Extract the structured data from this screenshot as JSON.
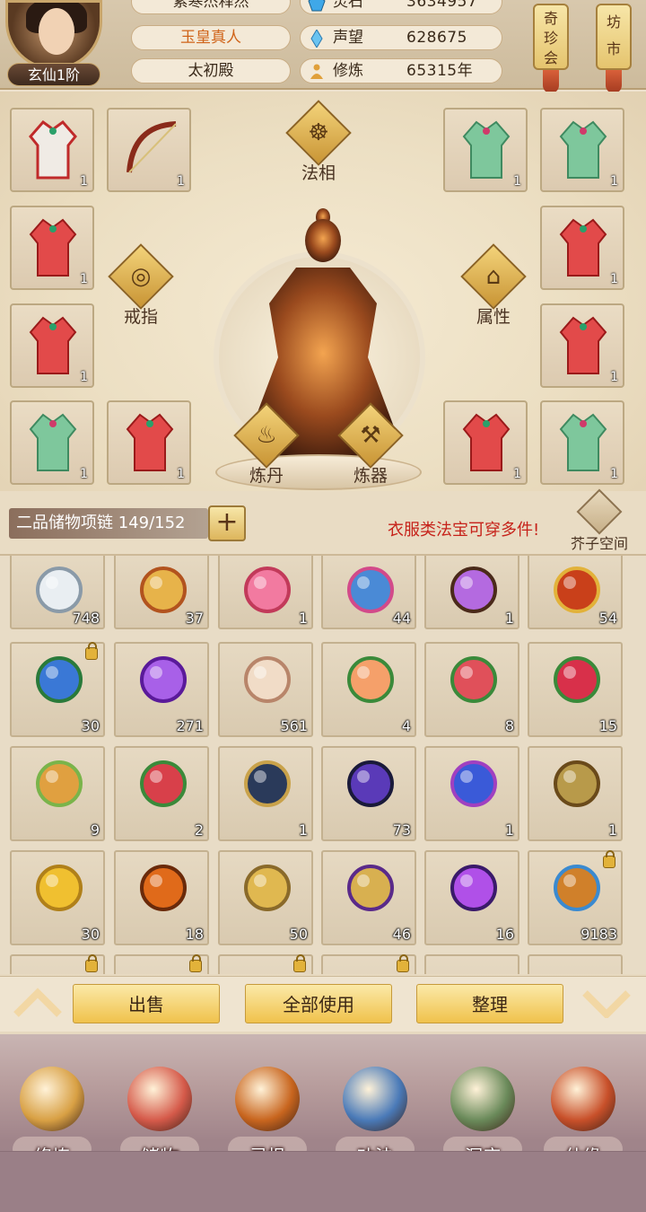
{
  "player": {
    "name": "紫寒杰释然",
    "title": "玉皇真人",
    "sect": "太初殿",
    "rank": "玄仙1阶"
  },
  "stats": [
    {
      "icon": "spirit-stone-icon",
      "label": "灵石",
      "value": "3634957"
    },
    {
      "icon": "prestige-crystal-icon",
      "label": "声望",
      "value": "628675"
    },
    {
      "icon": "meditation-icon",
      "label": "修炼",
      "value": "65315年"
    }
  ],
  "side_buttons": {
    "treasure_fair": "奇珍会",
    "market": "坊市"
  },
  "equip_labels": {
    "dharma": "法相",
    "ring": "戒指",
    "attributes": "属性",
    "alchemy": "炼丹",
    "forge": "炼器"
  },
  "equip_slots": [
    {
      "item": "robe-white-red",
      "count": "1"
    },
    {
      "item": "bow",
      "count": "1"
    },
    {
      "item": "robe-green",
      "count": "1"
    },
    {
      "item": "robe-green",
      "count": "1"
    },
    {
      "item": "robe-red",
      "count": "1"
    },
    {
      "item": "robe-red",
      "count": "1"
    },
    {
      "item": "robe-red",
      "count": "1"
    },
    {
      "item": "robe-red",
      "count": "1"
    },
    {
      "item": "robe-green",
      "count": "1"
    },
    {
      "item": "robe-red",
      "count": "1"
    },
    {
      "item": "robe-red",
      "count": "1"
    },
    {
      "item": "robe-green",
      "count": "1"
    }
  ],
  "storage": {
    "label": "二品储物项链",
    "count": "149/152",
    "hint": "衣服类法宝可穿多件!",
    "space_label": "芥子空间"
  },
  "inventory": [
    {
      "item": "silver-sphere",
      "count": "748",
      "locked": false
    },
    {
      "item": "gold-ring",
      "count": "37",
      "locked": false
    },
    {
      "item": "lotus",
      "count": "1",
      "locked": false
    },
    {
      "item": "scroll-blue",
      "count": "44",
      "locked": false
    },
    {
      "item": "purple-tree",
      "count": "1",
      "locked": false
    },
    {
      "item": "teapot",
      "count": "54",
      "locked": false
    },
    {
      "item": "blueberry-herb",
      "count": "30",
      "locked": true
    },
    {
      "item": "purple-crystal",
      "count": "271",
      "locked": false
    },
    {
      "item": "paper-scroll",
      "count": "561",
      "locked": false
    },
    {
      "item": "peach",
      "count": "4",
      "locked": false
    },
    {
      "item": "red-fruits",
      "count": "8",
      "locked": false
    },
    {
      "item": "raspberry",
      "count": "15",
      "locked": false
    },
    {
      "item": "flame-bud",
      "count": "9",
      "locked": false
    },
    {
      "item": "red-bud",
      "count": "2",
      "locked": false
    },
    {
      "item": "yinyang-mirror",
      "count": "1",
      "locked": false
    },
    {
      "item": "dark-crystal",
      "count": "73",
      "locked": false
    },
    {
      "item": "blue-flower",
      "count": "1",
      "locked": false
    },
    {
      "item": "cross-sticks",
      "count": "1",
      "locked": false
    },
    {
      "item": "gold-bar",
      "count": "30",
      "locked": false
    },
    {
      "item": "fire-orb",
      "count": "18",
      "locked": false
    },
    {
      "item": "talisman-gold",
      "count": "50",
      "locked": false
    },
    {
      "item": "talisman-purple",
      "count": "46",
      "locked": false
    },
    {
      "item": "purple-flame",
      "count": "16",
      "locked": false
    },
    {
      "item": "dragon-orb",
      "count": "9183",
      "locked": true
    },
    {
      "item": "partial",
      "count": "",
      "locked": true
    },
    {
      "item": "partial",
      "count": "",
      "locked": true
    },
    {
      "item": "partial",
      "count": "",
      "locked": true
    },
    {
      "item": "partial",
      "count": "",
      "locked": true
    },
    {
      "item": "partial",
      "count": "",
      "locked": false
    },
    {
      "item": "partial",
      "count": "",
      "locked": false
    }
  ],
  "actions": {
    "sell": "出售",
    "use_all": "全部使用",
    "sort": "整理"
  },
  "nav": [
    {
      "label": "修炼",
      "icon": "cultivate-icon",
      "color": "#d8a044"
    },
    {
      "label": "储物",
      "icon": "storage-bag-icon",
      "color": "#d55a4a"
    },
    {
      "label": "灵根",
      "icon": "spirit-root-icon",
      "color": "#c8651e"
    },
    {
      "label": "功法",
      "icon": "technique-book-icon",
      "color": "#4a7ab8"
    },
    {
      "label": "洞府",
      "icon": "cave-dwelling-icon",
      "color": "#6a8a5a"
    },
    {
      "label": "仙缘",
      "icon": "immortal-fate-icon",
      "color": "#c8502a"
    }
  ],
  "colors": {
    "accent_gold": "#f0c24c",
    "hint_red": "#c6221a",
    "rank_brown": "#3e2a1e"
  }
}
